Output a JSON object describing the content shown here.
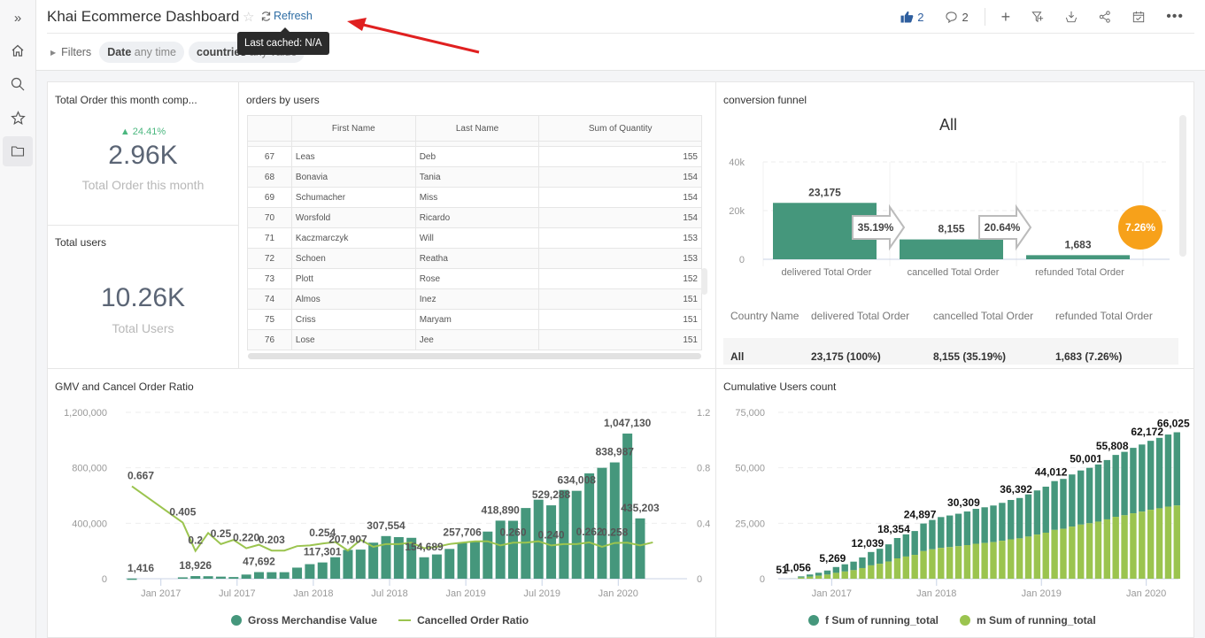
{
  "sidebar": {
    "items": [
      {
        "name": "expand",
        "icon": "»"
      },
      {
        "name": "home",
        "icon": "home-icon"
      },
      {
        "name": "search",
        "icon": "search-icon"
      },
      {
        "name": "favorites",
        "icon": "star-icon"
      },
      {
        "name": "folder",
        "icon": "folder-icon",
        "active": true
      }
    ]
  },
  "header": {
    "title": "Khai Ecommerce Dashboard",
    "refresh_label": "Refresh",
    "tooltip": "Last cached: N/A",
    "likes": "2",
    "comments": "2",
    "filters_label": "Filters",
    "filters": [
      {
        "key": "Date",
        "value": "any time"
      },
      {
        "key": "countries",
        "value": "any value"
      }
    ]
  },
  "kpi_orders": {
    "title": "Total Order this month comp...",
    "change": "▲ 24.41%",
    "value": "2.96K",
    "label": "Total Order this month"
  },
  "kpi_users": {
    "title": "Total users",
    "value": "10.26K",
    "label": "Total Users"
  },
  "orders_table": {
    "title": "orders by users",
    "columns": [
      "",
      "First Name",
      "Last Name",
      "Sum of Quantity"
    ],
    "rows": [
      [
        "67",
        "Leas",
        "Deb",
        "155"
      ],
      [
        "68",
        "Bonavia",
        "Tania",
        "154"
      ],
      [
        "69",
        "Schumacher",
        "Miss",
        "154"
      ],
      [
        "70",
        "Worsfold",
        "Ricardo",
        "154"
      ],
      [
        "71",
        "Kaczmarczyk",
        "Will",
        "153"
      ],
      [
        "72",
        "Schoen",
        "Reatha",
        "153"
      ],
      [
        "73",
        "Plott",
        "Rose",
        "152"
      ],
      [
        "74",
        "Almos",
        "Inez",
        "151"
      ],
      [
        "75",
        "Criss",
        "Maryam",
        "151"
      ],
      [
        "76",
        "Lose",
        "Jee",
        "151"
      ]
    ]
  },
  "funnel": {
    "title": "conversion funnel",
    "table_columns": [
      "Country Name",
      "delivered Total Order",
      "cancelled Total Order",
      "refunded Total Order"
    ],
    "table_row": [
      "All",
      "23,175 (100%)",
      "8,155 (35.19%)",
      "1,683 (7.26%)"
    ]
  },
  "colors": {
    "teal": "#45977c",
    "lime": "#9bc44f",
    "orange": "#f7a11a",
    "link": "#2e6da4",
    "annotation_red": "#e02020"
  },
  "chart_data": [
    {
      "id": "funnel",
      "type": "bar",
      "title": "All",
      "categories": [
        "delivered Total Order",
        "cancelled Total Order",
        "refunded Total Order"
      ],
      "values": [
        23175,
        8155,
        1683
      ],
      "value_labels": [
        "23,175",
        "8,155",
        "1,683"
      ],
      "step_labels": [
        "35.19%",
        "20.64%"
      ],
      "overall_label": "7.26%",
      "yticks": [
        "0",
        "20k",
        "40k"
      ],
      "ylim": [
        0,
        40000
      ]
    },
    {
      "id": "gmv",
      "type": "bar",
      "title": "GMV and Cancel Order Ratio",
      "xticks": [
        "Jan 2017",
        "Jul 2017",
        "Jan 2018",
        "Jul 2018",
        "Jan 2019",
        "Jul 2019",
        "Jan 2020"
      ],
      "yticks_left": [
        "0",
        "400,000",
        "800,000",
        "1,200,000"
      ],
      "yticks_right": [
        "0",
        "0.4",
        "0.8",
        "1.2"
      ],
      "ylim_left": [
        0,
        1200000
      ],
      "ylim_right": [
        0,
        1.2
      ],
      "x": [
        "2016-11",
        "2016-12",
        "2017-01",
        "2017-02",
        "2017-03",
        "2017-04",
        "2017-05",
        "2017-06",
        "2017-07",
        "2017-08",
        "2017-09",
        "2017-10",
        "2017-11",
        "2017-12",
        "2018-01",
        "2018-02",
        "2018-03",
        "2018-04",
        "2018-05",
        "2018-06",
        "2018-07",
        "2018-08",
        "2018-09",
        "2018-10",
        "2018-11",
        "2018-12",
        "2019-01",
        "2019-02",
        "2019-03",
        "2019-04",
        "2019-05",
        "2019-06",
        "2019-07",
        "2019-08",
        "2019-09",
        "2019-10",
        "2019-11",
        "2019-12",
        "2020-01",
        "2020-02",
        "2020-03",
        "2020-04"
      ],
      "series": [
        {
          "name": "Gross Merchandise Value",
          "kind": "bar",
          "values": [
            1416,
            0,
            0,
            0,
            10000,
            18926,
            18000,
            15000,
            12000,
            30000,
            47692,
            47000,
            47000,
            80000,
            105000,
            117301,
            155000,
            207907,
            210000,
            260000,
            307554,
            300000,
            295000,
            154689,
            175000,
            215000,
            257706,
            265000,
            340000,
            418890,
            418000,
            510000,
            570000,
            529288,
            640000,
            634008,
            760000,
            800000,
            838987,
            1047130,
            435203,
            0
          ],
          "labels": {
            "0": "1,416",
            "5": "18,926",
            "10": "47,692",
            "15": "117,301",
            "17": "207,907",
            "20": "307,554",
            "23": "154,689",
            "26": "257,706",
            "29": "418,890",
            "33": "529,288",
            "35": "634,008",
            "38": "838,987",
            "39": "1,047,130",
            "40": "435,203"
          }
        },
        {
          "name": "Cancelled Order Ratio",
          "kind": "line",
          "values": [
            0.667,
            null,
            null,
            null,
            0.405,
            0.2,
            0.33,
            0.25,
            0.28,
            0.22,
            0.245,
            0.203,
            0.203,
            0.235,
            0.24,
            0.254,
            0.265,
            0.203,
            0.28,
            0.23,
            0.25,
            0.25,
            0.26,
            0.22,
            0.23,
            0.25,
            0.26,
            0.27,
            0.27,
            0.24,
            0.26,
            0.26,
            0.27,
            0.24,
            0.25,
            0.25,
            0.262,
            0.23,
            0.258,
            0.26,
            0.24,
            0.262
          ],
          "labels": {
            "0": "0.667",
            "4": "0.405",
            "5": "0.2",
            "7": "0.25",
            "9": "0.220",
            "11": "0.203",
            "15": "0.254",
            "30": "0.260",
            "33": "0.240",
            "36": "0.262",
            "38": "0.258"
          }
        }
      ],
      "legend": "bottom"
    },
    {
      "id": "cumulative",
      "type": "bar",
      "title": "Cumulative Users count",
      "stacked": true,
      "xticks": [
        "Jan 2017",
        "Jan 2018",
        "Jan 2019",
        "Jan 2020"
      ],
      "yticks": [
        "0",
        "25,000",
        "50,000",
        "75,000"
      ],
      "ylim": [
        0,
        75000
      ],
      "x_count": 45,
      "series": [
        {
          "name": "f Sum of running_total",
          "color": "teal"
        },
        {
          "name": "m Sum of running_total",
          "color": "lime"
        }
      ],
      "totals": [
        51,
        1056,
        1900,
        2700,
        3700,
        5269,
        6500,
        7700,
        9600,
        12039,
        13500,
        15500,
        18354,
        20000,
        21500,
        24897,
        26500,
        27800,
        28500,
        29300,
        30309,
        31500,
        32200,
        33000,
        34200,
        35500,
        36392,
        38000,
        39800,
        41500,
        44012,
        45000,
        47000,
        48800,
        50001,
        51500,
        53500,
        55808,
        57200,
        59000,
        60500,
        62172,
        63500,
        65000,
        66025
      ],
      "m_share": 0.5,
      "labels": {
        "0": "51",
        "1": "1,056",
        "5": "5,269",
        "9": "12,039",
        "12": "18,354",
        "15": "24,897",
        "20": "30,309",
        "26": "36,392",
        "30": "44,012",
        "34": "50,001",
        "37": "55,808",
        "41": "62,172",
        "44": "66,025"
      },
      "legend": "bottom"
    }
  ]
}
